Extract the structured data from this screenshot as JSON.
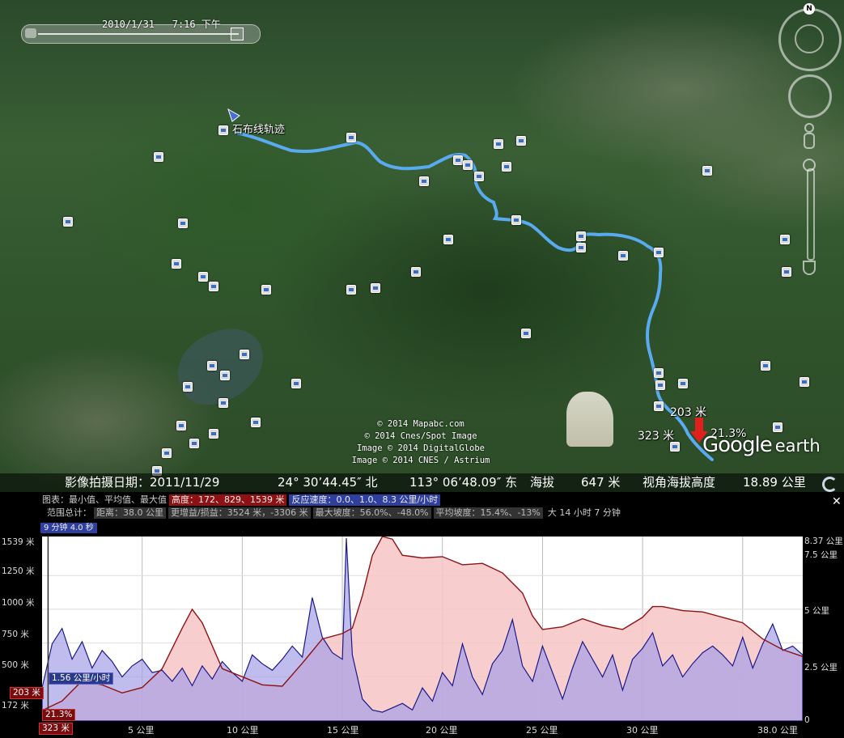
{
  "map": {
    "time_slider": {
      "date": "2010/1/31",
      "time": "7:16 下午"
    },
    "route_label": "石布线轨迹",
    "copyright": [
      "© 2014 Mapabc.com",
      "© 2014 Cnes/Spot Image",
      "Image © 2014 DigitalGlobe",
      "Image © 2014 CNES / Astrium"
    ],
    "cursor_elevation": "203 米",
    "cursor_elevation_left": "323 米",
    "cursor_slope": "21.3%",
    "logo": {
      "google": "Google",
      "earth": "earth"
    },
    "nav_north": "N",
    "status_bar": {
      "imagery_date": "影像拍摄日期：2011/11/29",
      "lat": "24° 30’44.45″ 北",
      "lon": "113° 06’48.09″ 东",
      "elev_label": "海拔",
      "elev_value": "647 米",
      "eye_alt_label": "视角海拔高度",
      "eye_alt_value": "18.89 公里"
    }
  },
  "profile": {
    "row1": {
      "label": "图表：最小值、平均值、最大值",
      "elevation": "高度：172、829、1539 米",
      "speed": "反应速度：0.0、1.0、8.3 公里/小时"
    },
    "row2": {
      "label": "范围总计：",
      "distance": "距离：38.0 公里",
      "gain": "更增益/损益：3524 米，-3306 米",
      "max_slope": "最大坡度：56.0%、-48.0%",
      "avg_slope": "平均坡度：15.4%、-13%",
      "time": "大 14 小时 7 分钟"
    },
    "cursor_time": "9 分钟 4.0 秒",
    "cursor_speed": "1.56 公里/小时",
    "cursor_elev": "203 米",
    "cursor_slope": "21.3%",
    "cursor_dist": "323 米",
    "y_left": [
      "1539 米",
      "1250 米",
      "1000 米",
      "750 米",
      "500 米",
      "172 米"
    ],
    "y_right": [
      "8.37 公里",
      "7.5 公里",
      "5 公里",
      "2.5 公里",
      "0"
    ],
    "x_labels": [
      "5 公里",
      "10 公里",
      "15 公里",
      "20 公里",
      "25 公里",
      "30 公里",
      "38.0 公里"
    ]
  },
  "chart_data": {
    "type": "area",
    "title": "",
    "xlabel": "",
    "ylabel": "",
    "xlim": [
      0,
      38.0
    ],
    "series": [
      {
        "name": "高度",
        "color": "#8e1214",
        "fill": "#f6c4c4",
        "ylim": [
          172,
          1539
        ],
        "x": [
          0,
          1,
          2,
          3,
          4,
          5,
          6,
          7,
          7.5,
          8,
          9,
          10,
          11,
          12,
          13,
          14,
          15,
          15.5,
          16,
          16.5,
          17,
          17.5,
          18,
          19,
          20,
          21,
          22,
          23,
          24,
          24.5,
          25,
          26,
          27,
          28,
          29,
          30,
          30.5,
          31,
          32,
          33,
          34,
          35,
          36,
          37,
          38
        ],
        "values": [
          250,
          320,
          470,
          440,
          380,
          420,
          560,
          860,
          1000,
          900,
          560,
          500,
          440,
          430,
          600,
          780,
          820,
          860,
          1100,
          1400,
          1539,
          1520,
          1400,
          1380,
          1390,
          1330,
          1340,
          1270,
          1120,
          950,
          850,
          870,
          930,
          880,
          850,
          940,
          1020,
          1020,
          990,
          980,
          940,
          900,
          780,
          700,
          650
        ]
      },
      {
        "name": "速度",
        "color": "#1a1a8a",
        "fill": "#a5a0e6",
        "ylim": [
          0,
          8.37
        ],
        "x": [
          0,
          0.5,
          1,
          1.5,
          2,
          2.5,
          3,
          3.5,
          4,
          4.5,
          5,
          5.5,
          6,
          6.5,
          7,
          7.5,
          8,
          8.5,
          9,
          9.5,
          10,
          10.5,
          11,
          11.5,
          12,
          12.5,
          13,
          13.5,
          14,
          14.5,
          15,
          15.2,
          15.5,
          16,
          16.5,
          17,
          17.5,
          18,
          18.5,
          19,
          19.5,
          20,
          20.5,
          21,
          21.5,
          22,
          22.5,
          23,
          23.5,
          24,
          24.5,
          25,
          25.5,
          26,
          26.5,
          27,
          27.5,
          28,
          28.5,
          29,
          29.5,
          30,
          30.5,
          31,
          31.5,
          32,
          32.5,
          33,
          33.5,
          34,
          34.5,
          35,
          35.5,
          36,
          36.5,
          37,
          37.5,
          38
        ],
        "values": [
          1.5,
          3.5,
          4.2,
          2.8,
          3.6,
          2.4,
          3.2,
          2.7,
          2.0,
          2.5,
          2.8,
          2.2,
          2.3,
          1.8,
          2.4,
          1.6,
          2.5,
          1.9,
          2.7,
          2.2,
          1.8,
          3.0,
          2.6,
          2.3,
          2.8,
          3.4,
          2.9,
          5.6,
          3.8,
          3.1,
          2.8,
          8.3,
          3.0,
          1.0,
          0.5,
          0.4,
          0.6,
          0.8,
          0.5,
          1.5,
          0.9,
          2.2,
          1.6,
          3.5,
          2.0,
          1.2,
          2.6,
          3.2,
          4.6,
          2.5,
          1.8,
          3.4,
          2.2,
          1.0,
          2.4,
          3.6,
          2.8,
          2.0,
          3.0,
          1.4,
          2.8,
          3.3,
          4.0,
          2.5,
          3.0,
          2.0,
          2.6,
          3.1,
          3.4,
          3.0,
          2.5,
          3.8,
          2.4,
          3.5,
          4.4,
          3.2,
          3.4,
          3.0
        ]
      }
    ]
  }
}
